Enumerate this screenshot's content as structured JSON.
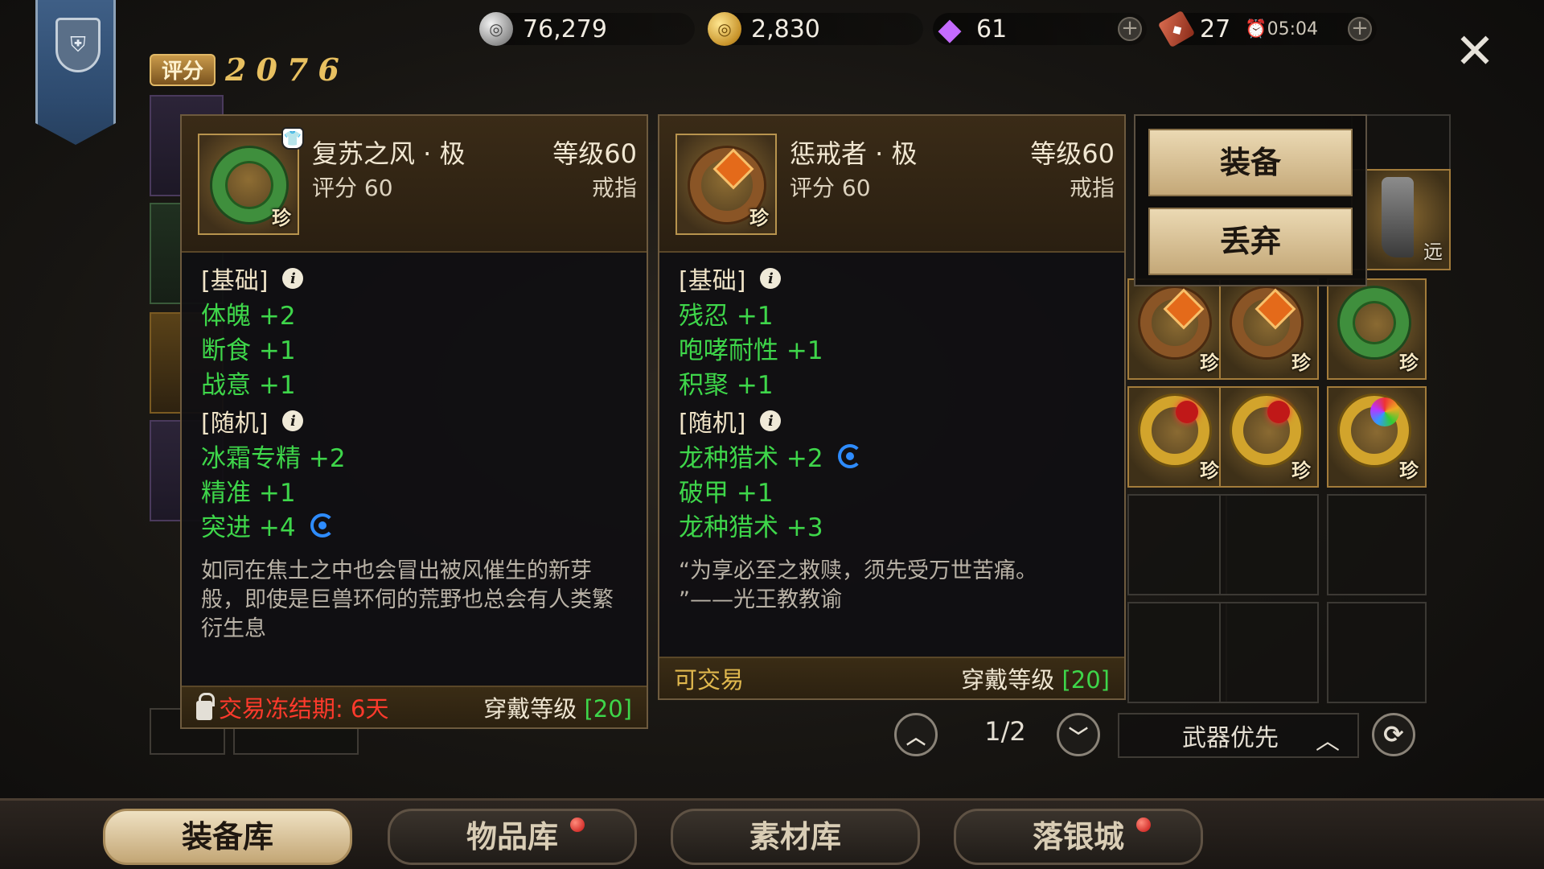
{
  "score": {
    "label": "评分",
    "value": "2076"
  },
  "currencies": {
    "silver": "76,279",
    "gold": "2,830",
    "gems": "61",
    "tickets": "27",
    "timer": "05:04"
  },
  "left_item": {
    "name": "复苏之风 · 极",
    "level": "等级60",
    "score": "评分 60",
    "type": "戒指",
    "rarity": "珍",
    "basic_title": "[基础]",
    "basic_stats": [
      "体魄 +2",
      "断食 +1",
      "战意 +1"
    ],
    "random_title": "[随机]",
    "random_stats": [
      "冰霜专精 +2",
      "精准 +1",
      "突进 +4"
    ],
    "flavor": "如同在焦土之中也会冒出被风催生的新芽般，即使是巨兽环伺的荒野也总会有人类繁衍生息",
    "trade_status": "交易冻结期: 6天",
    "wear_label": "穿戴等级 ",
    "wear_level": "[20]"
  },
  "right_item": {
    "name": "惩戒者 · 极",
    "level": "等级60",
    "score": "评分 60",
    "type": "戒指",
    "rarity": "珍",
    "basic_title": "[基础]",
    "basic_stats": [
      "残忍 +1",
      "咆哮耐性 +1",
      "积聚 +1"
    ],
    "random_title": "[随机]",
    "random_stats": [
      "龙种猎术 +2",
      "破甲 +1",
      "龙种猎术 +3"
    ],
    "flavor_line1": "“为享必至之救赎，须先受万世苦痛。",
    "flavor_line2": "”——光王教教谕",
    "trade_status": "可交易",
    "wear_label": "穿戴等级 ",
    "wear_level": "[20]"
  },
  "actions": {
    "equip": "装备",
    "discard": "丢弃"
  },
  "grid": {
    "rarity_mark": "珍",
    "far_mark": "远"
  },
  "pager": {
    "current": "1/2",
    "sort_label": "武器优先"
  },
  "tabs": [
    {
      "label": "装备库",
      "active": true,
      "badge": false
    },
    {
      "label": "物品库",
      "active": false,
      "badge": true
    },
    {
      "label": "素材库",
      "active": false,
      "badge": false
    },
    {
      "label": "落银城",
      "active": false,
      "badge": true
    }
  ],
  "icons": {
    "silver": "silver-coin-icon",
    "gold": "gold-coin-icon",
    "gem": "diamond-icon",
    "ticket": "ticket-icon",
    "close": "close-icon",
    "reroll": "reroll-icon",
    "info": "info-icon",
    "lock": "lock-icon"
  },
  "colors": {
    "stat_green": "#3ed64a",
    "frozen_red": "#ff3a2c",
    "tradable_gold": "#e0b84e",
    "reroll_blue": "#2e8cff",
    "score_gold": "#e8c060"
  }
}
